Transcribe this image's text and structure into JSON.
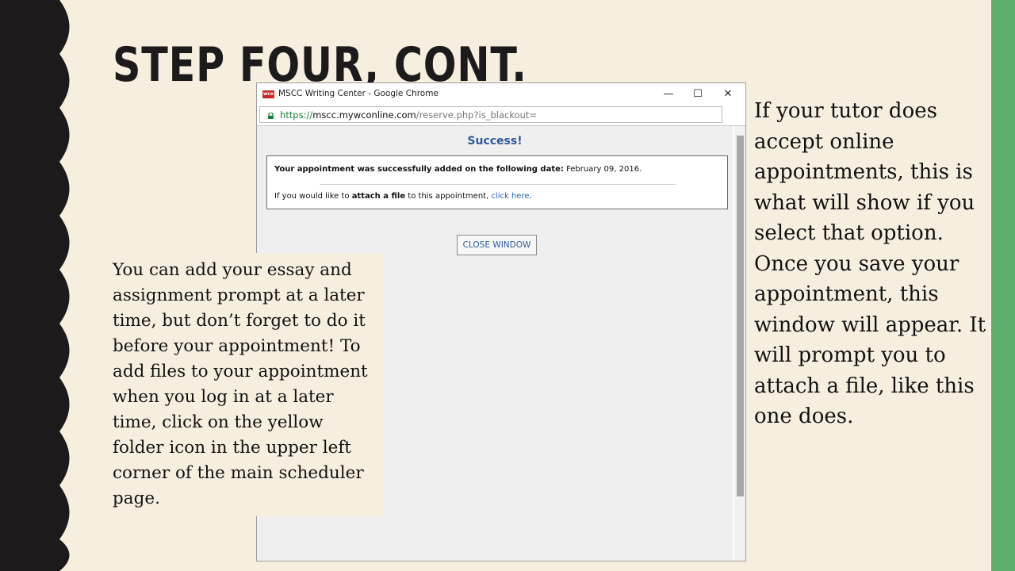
{
  "slide": {
    "title": "STEP FOUR, CONT.",
    "left_note": "You can add your essay and assignment prompt at a later time, but don’t forget to do it before your appointment! To add files to your appointment when you log in at a later time, click on the yellow folder icon in the upper left corner of the main scheduler page.",
    "right_note": "If your tutor does accept online appointments, this is what will show if you select that option. Once you save your appointment, this window will appear. It will prompt you to attach a file, like this one does."
  },
  "browser": {
    "app_icon_text": "wco",
    "window_title": "MSCC Writing Center - Google Chrome",
    "controls": {
      "minimize": "—",
      "maximize": "☐",
      "close": "✕"
    },
    "url": {
      "protocol": "https://",
      "host": "mscc.mywconline.com",
      "path": "/reserve.php?is_blackout="
    }
  },
  "page": {
    "heading": "Success!",
    "message": {
      "line1_bold": "Your appointment was successfully added on the following date:",
      "line1_date": " February 09, 2016.",
      "line2_prefix": "If you would like to ",
      "line2_bold": "attach a file",
      "line2_mid": " to this appointment, ",
      "line2_link": "click here",
      "line2_end": "."
    },
    "close_button": "CLOSE WINDOW"
  },
  "colors": {
    "background": "#f6efdf",
    "left_band": "#1c1a1a",
    "right_band": "#5daf6b",
    "accent_blue": "#2d5a9b",
    "link_blue": "#2a63b0",
    "url_green": "#188038"
  }
}
